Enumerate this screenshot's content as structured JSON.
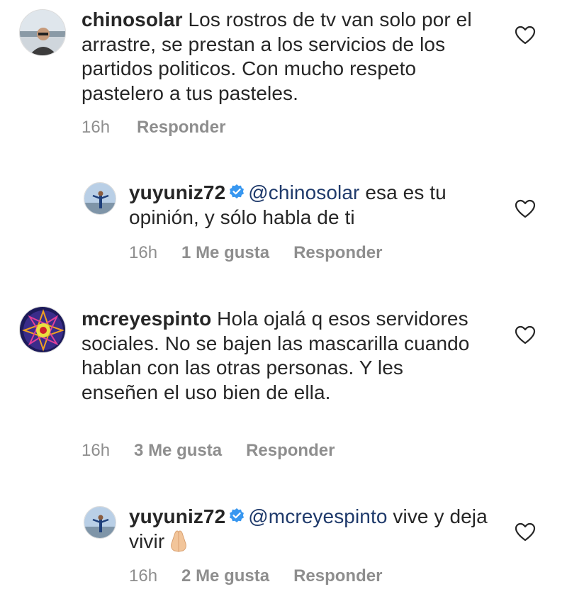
{
  "comments": [
    {
      "username": "chinosolar",
      "text": " Los rostros de tv van solo por el arrastre, se prestan a los servicios de los partidos politicos. Con mucho respeto pastelero a tus pasteles.",
      "time": "16h",
      "reply_label": "Responder",
      "avatar_icon": "user-photo-avatar"
    },
    {
      "username": "yuyuniz72",
      "verified": true,
      "mention": "@chinosolar",
      "text": " esa es tu opinión, y sólo habla de ti",
      "time": "16h",
      "likes": "1 Me gusta",
      "reply_label": "Responder",
      "avatar_icon": "user-photo-avatar"
    },
    {
      "username": "mcreyespinto",
      "text": " Hola ojalá q esos servidores sociales. No se bajen las mascarilla cuando hablan con las otras personas. Y les enseñen el uso bien de ella.",
      "time": "16h",
      "likes": "3 Me gusta",
      "reply_label": "Responder",
      "avatar_icon": "mandala-avatar"
    },
    {
      "username": "yuyuniz72",
      "verified": true,
      "mention": "@mcreyespinto",
      "text": " vive y deja vivir",
      "emoji": "folded-hands-emoji",
      "time": "16h",
      "likes": "2 Me gusta",
      "reply_label": "Responder",
      "avatar_icon": "user-photo-avatar"
    }
  ],
  "colors": {
    "text": "#262626",
    "meta": "#8e8e8e",
    "mention": "#1f3a6b",
    "verified": "#3897f0"
  }
}
